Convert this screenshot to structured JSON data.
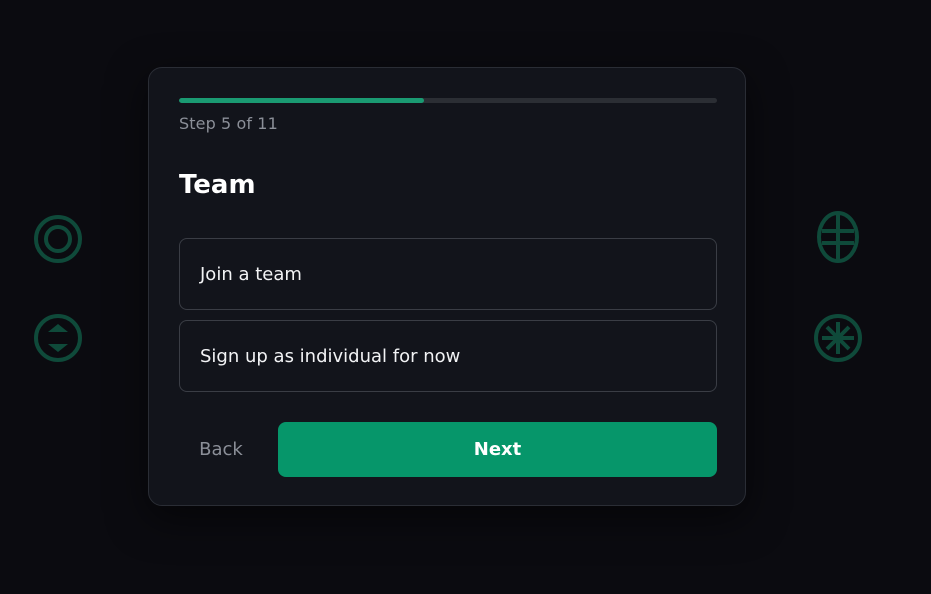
{
  "onboarding": {
    "step_label": "Step 5 of 11",
    "progress_fraction": 0.4545,
    "title": "Team",
    "options": [
      {
        "label": "Join a team"
      },
      {
        "label": "Sign up as individual for now"
      }
    ],
    "back_label": "Back",
    "next_label": "Next"
  },
  "decorations": [
    {
      "icon": "concentric-circle-icon"
    },
    {
      "icon": "circle-diamond-icon"
    },
    {
      "icon": "circle-cross-icon"
    },
    {
      "icon": "circle-asterisk-icon"
    }
  ],
  "colors": {
    "background": "#0b0b10",
    "card": "#12141b",
    "accent": "#06966a",
    "progress": "#1a9a72",
    "muted_text": "#8b8f98",
    "decoration": "#0f4a3a"
  }
}
